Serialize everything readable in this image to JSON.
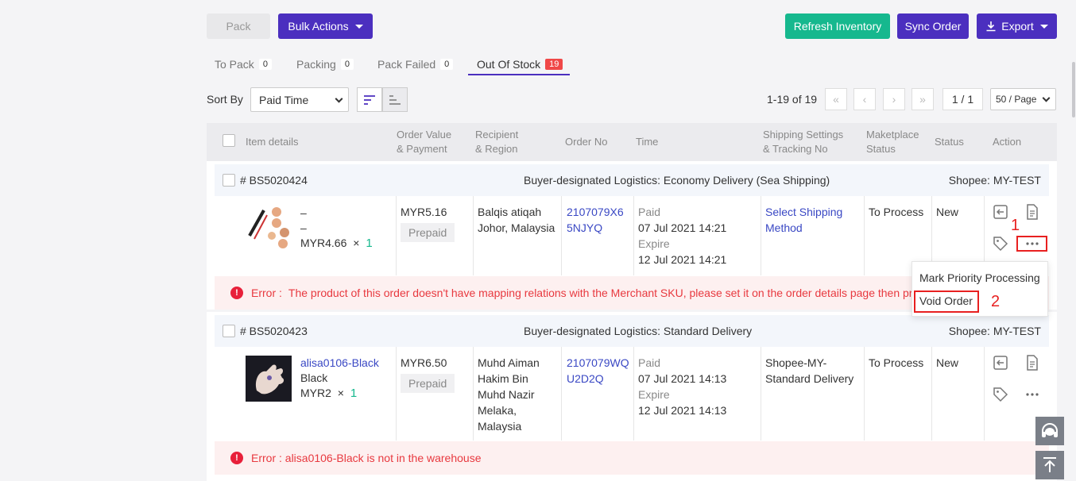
{
  "toolbar": {
    "pack_label": "Pack",
    "bulk_label": "Bulk Actions",
    "refresh_label": "Refresh Inventory",
    "sync_label": "Sync Order",
    "export_label": "Export"
  },
  "tabs": [
    {
      "label": "To Pack",
      "count": "0"
    },
    {
      "label": "Packing",
      "count": "0"
    },
    {
      "label": "Pack Failed",
      "count": "0"
    },
    {
      "label": "Out Of Stock",
      "count": "19"
    }
  ],
  "sort": {
    "label": "Sort By",
    "value": "Paid Time"
  },
  "pagination": {
    "range": "1-19 of 19",
    "page": "1 / 1",
    "per_page": "50 / Page"
  },
  "columns": {
    "item": "Item details",
    "value1": "Order Value",
    "value2": "& Payment",
    "recip1": "Recipient",
    "recip2": "& Region",
    "order_no": "Order No",
    "time": "Time",
    "ship1": "Shipping Settings",
    "ship2": "& Tracking No",
    "mkt1": "Maketplace",
    "mkt2": "Status",
    "status": "Status",
    "action": "Action"
  },
  "orders": [
    {
      "id": "# BS5020424",
      "logistics": "Buyer-designated Logistics: Economy Delivery (Sea Shipping)",
      "store": "Shopee: MY-TEST",
      "item_line1": "–",
      "item_line2": "–",
      "item_price": "MYR4.66",
      "item_x": "×",
      "item_qty": "1",
      "value": "MYR5.16",
      "payment": "Prepaid",
      "recipient_line1": "Balqis atiqah",
      "recipient_line2": "Johor, Malaysia",
      "order_no_line1": "2107079X6",
      "order_no_line2": "5NJYQ",
      "paid_label": "Paid",
      "paid_time": "07 Jul 2021 14:21",
      "expire_label": "Expire",
      "expire_time": "12 Jul 2021 14:21",
      "ship_line1": "Select Shipping",
      "ship_line2": "Method",
      "mkt_status": "To Process",
      "status": "New",
      "error_prefix": "Error :",
      "error": "The product of this order doesn't have mapping relations with the Merchant SKU, please set it on the order details page then process it"
    },
    {
      "id": "# BS5020423",
      "logistics": "Buyer-designated Logistics: Standard Delivery",
      "store": "Shopee: MY-TEST",
      "item_line1": "alisa0106-Black",
      "item_line2": "Black",
      "item_price": "MYR2",
      "item_x": "×",
      "item_qty": "1",
      "value": "MYR6.50",
      "payment": "Prepaid",
      "recipient_line1": "Muhd Aiman",
      "recipient_line2": "Hakim Bin",
      "recipient_line3": "Muhd Nazir",
      "recipient_line4": "Melaka,",
      "recipient_line5": "Malaysia",
      "order_no_line1": "2107079WQ",
      "order_no_line2": "U2D2Q",
      "paid_label": "Paid",
      "paid_time": "07 Jul 2021 14:13",
      "expire_label": "Expire",
      "expire_time": "12 Jul 2021 14:13",
      "ship_line1": "Shopee-MY-",
      "ship_line2": "Standard Delivery",
      "mkt_status": "To Process",
      "status": "New",
      "error": "Error : alisa0106-Black is not in the warehouse"
    }
  ],
  "popup": {
    "item1": "Mark Priority Processing",
    "item2": "Void Order"
  },
  "annotations": {
    "one": "1",
    "two": "2"
  },
  "colors": {
    "primary": "#4b2fbf",
    "success": "#16b88e",
    "danger": "#e82020"
  }
}
